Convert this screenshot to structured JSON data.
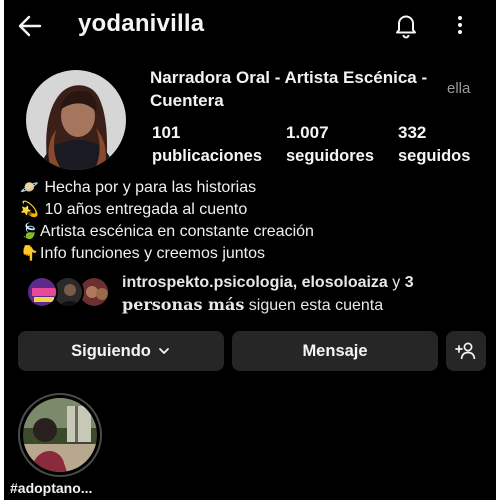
{
  "header": {
    "username": "yodanivilla",
    "back_icon": "arrow-left-icon",
    "notifications_icon": "bell-icon",
    "menu_icon": "more-vertical-icon"
  },
  "profile": {
    "display_name": "Narradora Oral - Artista Escénica - Cuentera",
    "pronoun": "ella",
    "stats": [
      {
        "value": "101",
        "label": "publicaciones"
      },
      {
        "value": "1.007",
        "label": "seguidores"
      },
      {
        "value": "332",
        "label": "seguidos"
      }
    ]
  },
  "bio": [
    {
      "emoji": "🪐",
      "text": " Hecha por y para las historias"
    },
    {
      "emoji": "💫",
      "text": " 10 años entregada al cuento"
    },
    {
      "emoji": "🍃",
      "text": "Artista escénica en constante creación"
    },
    {
      "emoji": "👇",
      "text": "Info funciones y creemos juntos"
    }
  ],
  "followed_by": {
    "names": "introspekto.psicologia, elosoloaiza",
    "connector": " y ",
    "count": "3",
    "count_suffix": "personas más",
    "trailing": " siguen esta cuenta"
  },
  "buttons": {
    "following": "Siguiendo",
    "message": "Mensaje",
    "add_person_icon": "add-person-icon"
  },
  "highlights": [
    {
      "label": "#adoptano..."
    }
  ],
  "colors": {
    "background": "#000000",
    "button_bg": "#262626",
    "text_primary": "#f5f5f5",
    "text_muted": "#9a9a9a"
  }
}
